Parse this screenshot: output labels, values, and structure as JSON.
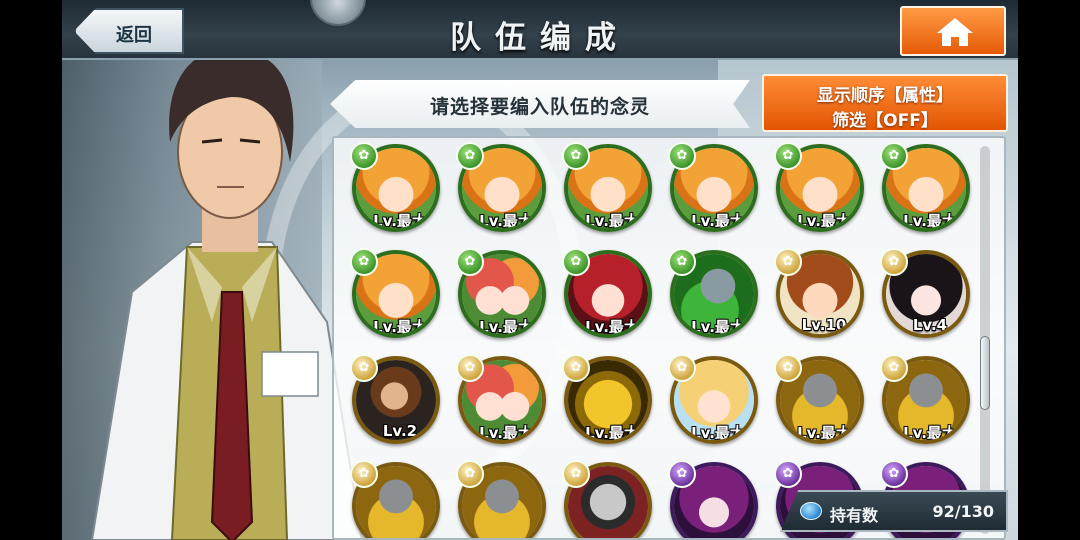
{
  "header": {
    "title": "队伍编成",
    "back_label": "返回"
  },
  "banner": {
    "text": "请选择要编入队伍的念灵"
  },
  "sort": {
    "order_label": "显示顺序【属性】",
    "filter_label": "筛选【OFF】"
  },
  "owned": {
    "label": "持有数",
    "value": "92/130"
  },
  "colors": {
    "orange_button": "#e65a06",
    "green_frame": "#2d6e1e",
    "gold_frame": "#7a5a10",
    "purple_frame": "#3d1a5c"
  },
  "units": [
    {
      "level": "Lv.最大",
      "stars": "★★★",
      "frame": "green",
      "portrait": "orange"
    },
    {
      "level": "Lv.最大",
      "stars": "★★★",
      "frame": "green",
      "portrait": "orange"
    },
    {
      "level": "Lv.最大",
      "stars": "★★★",
      "frame": "green",
      "portrait": "orange"
    },
    {
      "level": "Lv.最大",
      "stars": "★★★",
      "frame": "green",
      "portrait": "orange"
    },
    {
      "level": "Lv.最大",
      "stars": "★★★",
      "frame": "green",
      "portrait": "orange"
    },
    {
      "level": "Lv.最大",
      "stars": "★★★",
      "frame": "green",
      "portrait": "orange"
    },
    {
      "level": "Lv.最大",
      "stars": "★★★",
      "frame": "green",
      "portrait": "orange"
    },
    {
      "level": "Lv.最大",
      "stars": "★★★★",
      "frame": "green",
      "portrait": "twin"
    },
    {
      "level": "Lv.最大",
      "stars": "★★★★★",
      "frame": "green",
      "portrait": "red"
    },
    {
      "level": "Lv.最大",
      "stars": "★",
      "frame": "green",
      "portrait": "wolfgreen"
    },
    {
      "level": "Lv.10",
      "stars": "★★",
      "frame": "gold",
      "portrait": "brown"
    },
    {
      "level": "Lv.4",
      "stars": "★★",
      "frame": "gold",
      "portrait": "dark"
    },
    {
      "level": "Lv.2",
      "stars": "★",
      "frame": "gold",
      "portrait": "warrior"
    },
    {
      "level": "Lv.最大",
      "stars": "★★★★",
      "frame": "gold",
      "portrait": "twin"
    },
    {
      "level": "Lv.最大",
      "stars": "★★★",
      "frame": "gold",
      "portrait": "demon"
    },
    {
      "level": "Lv.最大",
      "stars": "★★★★★",
      "frame": "gold",
      "portrait": "blonde"
    },
    {
      "level": "Lv.最大",
      "stars": "★",
      "frame": "gold",
      "portrait": "wolfgold"
    },
    {
      "level": "Lv.最大",
      "stars": "★",
      "frame": "gold",
      "portrait": "wolfgold"
    },
    {
      "level": "",
      "stars": "",
      "frame": "gold",
      "portrait": "wolfgold"
    },
    {
      "level": "",
      "stars": "",
      "frame": "gold",
      "portrait": "wolfgold"
    },
    {
      "level": "",
      "stars": "",
      "frame": "gold",
      "portrait": "mask"
    },
    {
      "level": "",
      "stars": "",
      "frame": "purple",
      "portrait": "violet"
    },
    {
      "level": "",
      "stars": "",
      "frame": "purple",
      "portrait": "violet"
    },
    {
      "level": "",
      "stars": "",
      "frame": "purple",
      "portrait": "violet"
    }
  ]
}
